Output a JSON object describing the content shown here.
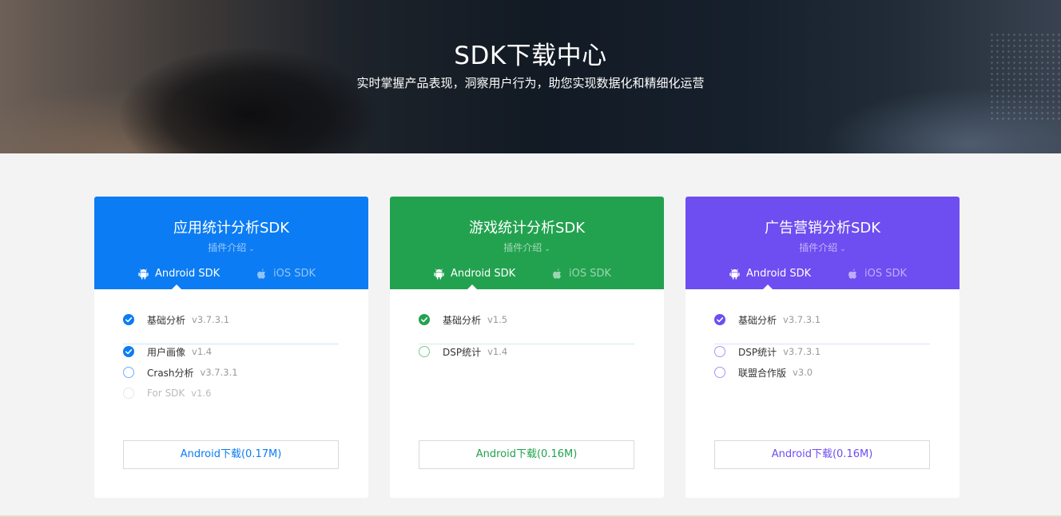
{
  "hero": {
    "title": "SDK下载中心",
    "subtitle": "实时掌握产品表现，洞察用户行为，助您实现数据化和精细化运营"
  },
  "cards": [
    {
      "title": "应用统计分析SDK",
      "plugin_label": "插件介绍",
      "plugin_chevron": "⌄",
      "color": "#0c7cf4",
      "tabs": [
        {
          "label": "Android SDK",
          "icon": "android-icon",
          "active": true
        },
        {
          "label": "iOS SDK",
          "icon": "apple-icon",
          "active": false
        }
      ],
      "items": [
        {
          "label": "基础分析",
          "version": "v3.7.3.1",
          "checked": true,
          "disabled": false
        },
        {
          "label": "用户画像",
          "version": "v1.4",
          "checked": true,
          "disabled": false
        },
        {
          "label": "Crash分析",
          "version": "v3.7.3.1",
          "checked": false,
          "disabled": false
        },
        {
          "label": "For SDK",
          "version": "v1.6",
          "checked": false,
          "disabled": true
        }
      ],
      "download_label": "Android下载(0.17M)"
    },
    {
      "title": "游戏统计分析SDK",
      "plugin_label": "插件介绍",
      "plugin_chevron": "⌄",
      "color": "#22a24f",
      "tabs": [
        {
          "label": "Android SDK",
          "icon": "android-icon",
          "active": true
        },
        {
          "label": "iOS SDK",
          "icon": "apple-icon",
          "active": false
        }
      ],
      "items": [
        {
          "label": "基础分析",
          "version": "v1.5",
          "checked": true,
          "disabled": false
        },
        {
          "label": "DSP统计",
          "version": "v1.4",
          "checked": false,
          "disabled": false
        }
      ],
      "download_label": "Android下载(0.16M)"
    },
    {
      "title": "广告营销分析SDK",
      "plugin_label": "插件介绍",
      "plugin_chevron": "⌄",
      "color": "#6e4df1",
      "tabs": [
        {
          "label": "Android SDK",
          "icon": "android-icon",
          "active": true
        },
        {
          "label": "iOS SDK",
          "icon": "apple-icon",
          "active": false
        }
      ],
      "items": [
        {
          "label": "基础分析",
          "version": "v3.7.3.1",
          "checked": true,
          "disabled": false
        },
        {
          "label": "DSP统计",
          "version": "v3.7.3.1",
          "checked": false,
          "disabled": false
        },
        {
          "label": "联盟合作版",
          "version": "v3.0",
          "checked": false,
          "disabled": false
        }
      ],
      "download_label": "Android下载(0.16M)"
    }
  ]
}
